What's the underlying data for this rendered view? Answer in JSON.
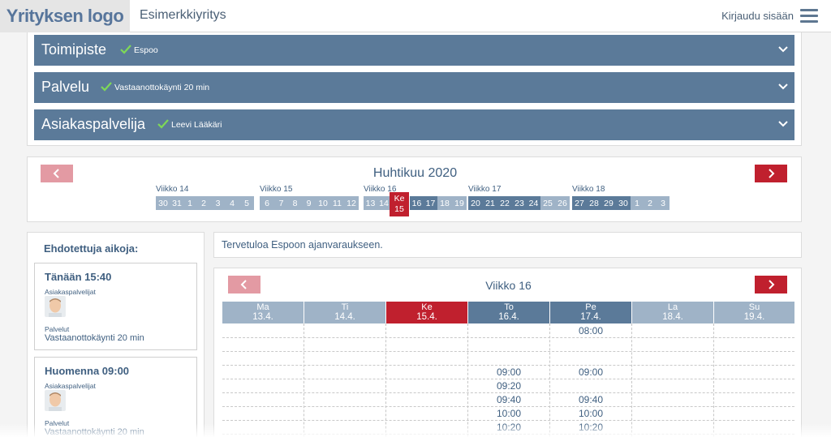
{
  "header": {
    "logo_text": "Yrityksen logo",
    "company_name": "Esimerkkiyritys",
    "login_label": "Kirjaudu sisään",
    "menu_icon": "hamburger-icon"
  },
  "selections": [
    {
      "title": "Toimipiste",
      "value": "Espoo"
    },
    {
      "title": "Palvelu",
      "value": "Vastaanottokäynti 20 min"
    },
    {
      "title": "Asiakaspalvelija",
      "value": "Leevi Lääkäri"
    }
  ],
  "month_nav": {
    "title": "Huhtikuu 2020",
    "prev_icon": "chevron-left-icon",
    "next_icon": "chevron-right-icon",
    "weeks": [
      {
        "label": "Viikko 14",
        "days": [
          "30",
          "31",
          "1",
          "2",
          "3",
          "4",
          "5"
        ],
        "style": "light"
      },
      {
        "label": "Viikko 15",
        "days": [
          "6",
          "7",
          "8",
          "9",
          "10",
          "11",
          "12"
        ],
        "style": "light"
      },
      {
        "label": "Viikko 16",
        "days": [
          "13",
          "14",
          "15",
          "16",
          "17",
          "18",
          "19"
        ],
        "style": "mixed"
      },
      {
        "label": "Viikko 17",
        "days": [
          "20",
          "21",
          "22",
          "23",
          "24",
          "25",
          "26"
        ],
        "style": "mixed"
      },
      {
        "label": "Viikko 18",
        "days": [
          "27",
          "28",
          "29",
          "30",
          "1",
          "2",
          "3"
        ],
        "style": "mixed"
      }
    ],
    "today": {
      "weekday": "Ke",
      "day": "15"
    }
  },
  "suggestions": {
    "title": "Ehdotettuja aikoja:",
    "staff_label": "Asiakaspalvelijat",
    "service_label": "Palvelut",
    "items": [
      {
        "time": "Tänään 15:40",
        "service": "Vastaanottokäynti 20 min"
      },
      {
        "time": "Huomenna 09:00",
        "service": "Vastaanottokäynti 20 min"
      }
    ]
  },
  "welcome_text": "Tervetuloa Espoon ajanvaraukseen.",
  "week_view": {
    "title": "Viikko 16",
    "days": [
      {
        "name": "Ma",
        "date": "13.4.",
        "style": "light"
      },
      {
        "name": "Ti",
        "date": "14.4.",
        "style": "light"
      },
      {
        "name": "Ke",
        "date": "15.4.",
        "style": "today"
      },
      {
        "name": "To",
        "date": "16.4.",
        "style": "dark"
      },
      {
        "name": "Pe",
        "date": "17.4.",
        "style": "dark"
      },
      {
        "name": "La",
        "date": "18.4.",
        "style": "light"
      },
      {
        "name": "Su",
        "date": "19.4.",
        "style": "light"
      }
    ],
    "slots": {
      "to": [
        "09:00",
        "09:20",
        "09:40",
        "10:00",
        "10:20"
      ],
      "pe": [
        "08:00",
        "09:00",
        "09:40",
        "10:00",
        "10:20"
      ]
    }
  },
  "colors": {
    "primary": "#5b7a99",
    "light": "#9fb3c7",
    "accent": "#c0202e",
    "accent_light": "#e39aa3"
  }
}
